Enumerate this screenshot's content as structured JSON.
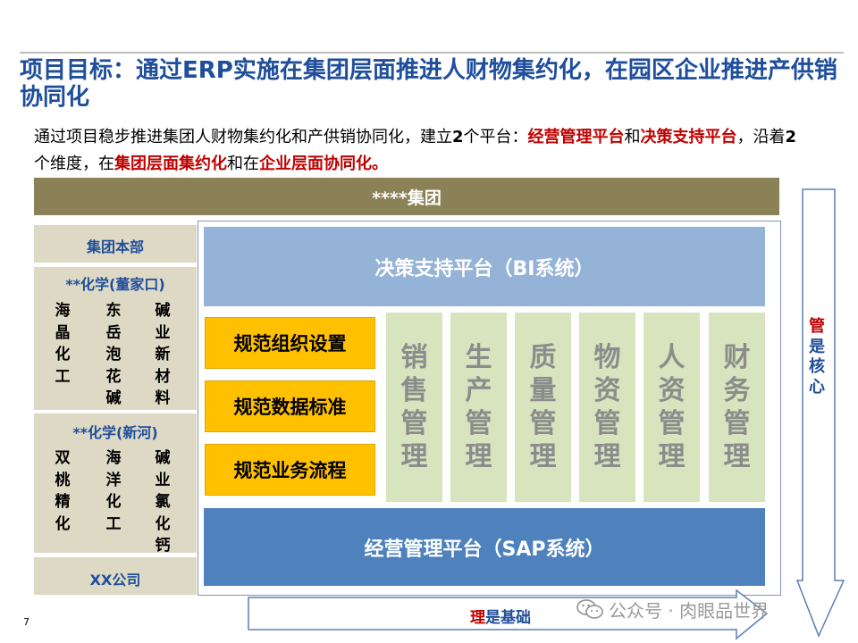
{
  "title": "项目目标：通过ERP实施在集团层面推进人财物集约化，在园区企业推进产供销协同化",
  "intro": {
    "p1": "通过项目稳步推进集团人财物集约化和产供销协同化，建立",
    "num1": "2",
    "p2": "个平台：",
    "platform1": "经营管理平台",
    "p3": "和",
    "platform2": "决策支持平台",
    "p4": "，沿着",
    "num2": "2",
    "p5": "个维度，在",
    "dim1": "集团层面集约化",
    "p6": "和在",
    "dim2": "企业层面协同化。"
  },
  "group_bar": "****集团",
  "left": {
    "hq": "集团本部",
    "chem1": {
      "title": "**化学(董家口)",
      "cols": [
        "海晶化工",
        "东岳泡花碱",
        "碱业新材料"
      ]
    },
    "chem2": {
      "title": "**化学(新河)",
      "cols": [
        "双桃精化",
        "海洋化工",
        "碱业氯化钙"
      ]
    },
    "xx": "XX公司"
  },
  "bi_bar": "决策支持平台（BI系统）",
  "norms": [
    "规范组织设置",
    "规范数据标准",
    "规范业务流程"
  ],
  "modules": [
    "销售管理",
    "生产管理",
    "质量管理",
    "物资管理",
    "人资管理",
    "财务管理"
  ],
  "sap_bar": "经营管理平台（SAP系统）",
  "side": {
    "red": "管",
    "rest": "是核心"
  },
  "bottom": {
    "red": "理",
    "rest": "是基础"
  },
  "page_number": "7",
  "watermark": "公众号 · 肉眼品世界",
  "colors": {
    "title_blue": "#1f4e9b",
    "accent_red": "#c00000",
    "group_olive": "#8b8156",
    "left_tan": "#ddd9c4",
    "bi_blue": "#95b3d7",
    "sap_blue": "#4f81bd",
    "norm_yellow": "#ffc000",
    "module_green": "#d7e4bd"
  }
}
